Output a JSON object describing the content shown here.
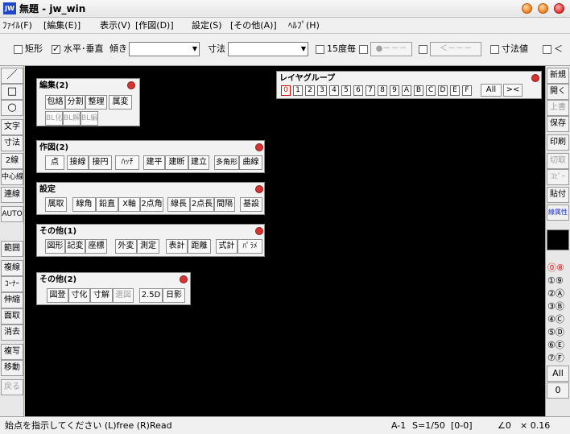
{
  "window": {
    "icon_text": "JW",
    "title": "無題 - jw_win"
  },
  "menubar": {
    "items": [
      "ﾌｧｲﾙ(F)",
      "[編集(E)]",
      "表示(V)",
      "[作図(D)]",
      "設定(S)",
      "[その他(A)]",
      "ﾍﾙﾌﾟ(H)"
    ]
  },
  "toolbar": {
    "rect_label": "矩形",
    "rect_checked": false,
    "hv_label": "水平･垂直",
    "hv_checked": true,
    "slope_label": "傾き",
    "slope_value": "",
    "dim_label": "寸法",
    "dim_value": "",
    "deg15_label": "15度毎",
    "deg15_checked": false,
    "box1_text": "●－－－",
    "box2_text": "＜－－－",
    "dimval_label": "寸法値",
    "lt_label": "＜"
  },
  "left_column": {
    "items": [
      {
        "label": "／",
        "disabled": false
      },
      {
        "label": "□",
        "disabled": false
      },
      {
        "label": "○",
        "disabled": false
      },
      {
        "label": "文字",
        "disabled": false
      },
      {
        "label": "寸法",
        "disabled": false
      },
      {
        "label": "2線",
        "disabled": false
      },
      {
        "label": "中心線",
        "disabled": false
      },
      {
        "label": "連線",
        "disabled": false
      },
      {
        "label": "AUTO",
        "disabled": false
      },
      {
        "label": "範囲",
        "disabled": false
      },
      {
        "label": "複線",
        "disabled": false
      },
      {
        "label": "ｺｰﾅｰ",
        "disabled": false
      },
      {
        "label": "伸縮",
        "disabled": false
      },
      {
        "label": "面取",
        "disabled": false
      },
      {
        "label": "消去",
        "disabled": false
      },
      {
        "label": "複写",
        "disabled": false
      },
      {
        "label": "移動",
        "disabled": false
      },
      {
        "label": "戻る",
        "disabled": true
      }
    ]
  },
  "right_column": {
    "items": [
      {
        "label": "新規",
        "disabled": false
      },
      {
        "label": "開く",
        "disabled": false
      },
      {
        "label": "上書",
        "disabled": true
      },
      {
        "label": "保存",
        "disabled": false
      },
      {
        "label": "印刷",
        "disabled": false
      },
      {
        "label": "切取",
        "disabled": true
      },
      {
        "label": "ｺﾋﾟｰ",
        "disabled": true
      },
      {
        "label": "貼付",
        "disabled": false
      },
      {
        "label": "線属性",
        "disabled": false
      }
    ],
    "layers": [
      "⓪⑧",
      "①⑨",
      "②Ⓐ",
      "③Ⓑ",
      "④Ⓒ",
      "⑤Ⓓ",
      "⑥Ⓔ",
      "⑦Ⓕ"
    ],
    "all_label": "All",
    "layer_value": "0"
  },
  "panels": {
    "edit": {
      "title": "編集(2)",
      "row1": [
        "包絡",
        "分割",
        "整理",
        "属変"
      ],
      "row2": [
        "BL化",
        "BL解",
        "BL編"
      ]
    },
    "draw": {
      "title": "作図(2)",
      "buttons": [
        "点",
        "接線",
        "接円",
        "ﾊｯﾁ",
        "建平",
        "建断",
        "建立",
        "多角形",
        "曲線"
      ]
    },
    "settings": {
      "title": "設定",
      "buttons": [
        "属取",
        "線角",
        "鉛直",
        "X軸",
        "2点角",
        "線長",
        "2点長",
        "間隔",
        "基設"
      ]
    },
    "other1": {
      "title": "その他(1)",
      "buttons": [
        "図形",
        "記変",
        "座標",
        "外変",
        "測定",
        "表計",
        "距離",
        "式計",
        "ﾊﾟﾗﾒ"
      ]
    },
    "other2": {
      "title": "その他(2)",
      "buttons": [
        "図登",
        "寸化",
        "寸解",
        "選図",
        "2.5D",
        "日影"
      ]
    },
    "layergroup": {
      "title": "レイヤグループ",
      "cells": [
        "0",
        "1",
        "2",
        "3",
        "4",
        "5",
        "6",
        "7",
        "8",
        "9",
        "A",
        "B",
        "C",
        "D",
        "E",
        "F"
      ],
      "all_label": "All",
      "close_label": "><"
    }
  },
  "statusbar": {
    "message": "始点を指示してください (L)free (R)Read",
    "paper": "A-1",
    "scale": "S=1/50",
    "layer": "[0-0]",
    "angle": "∠0",
    "factor": "× 0.16"
  },
  "colors": {
    "canvas": "#000000",
    "selected_layer": "#d01010",
    "close_dot": "#d63333"
  }
}
